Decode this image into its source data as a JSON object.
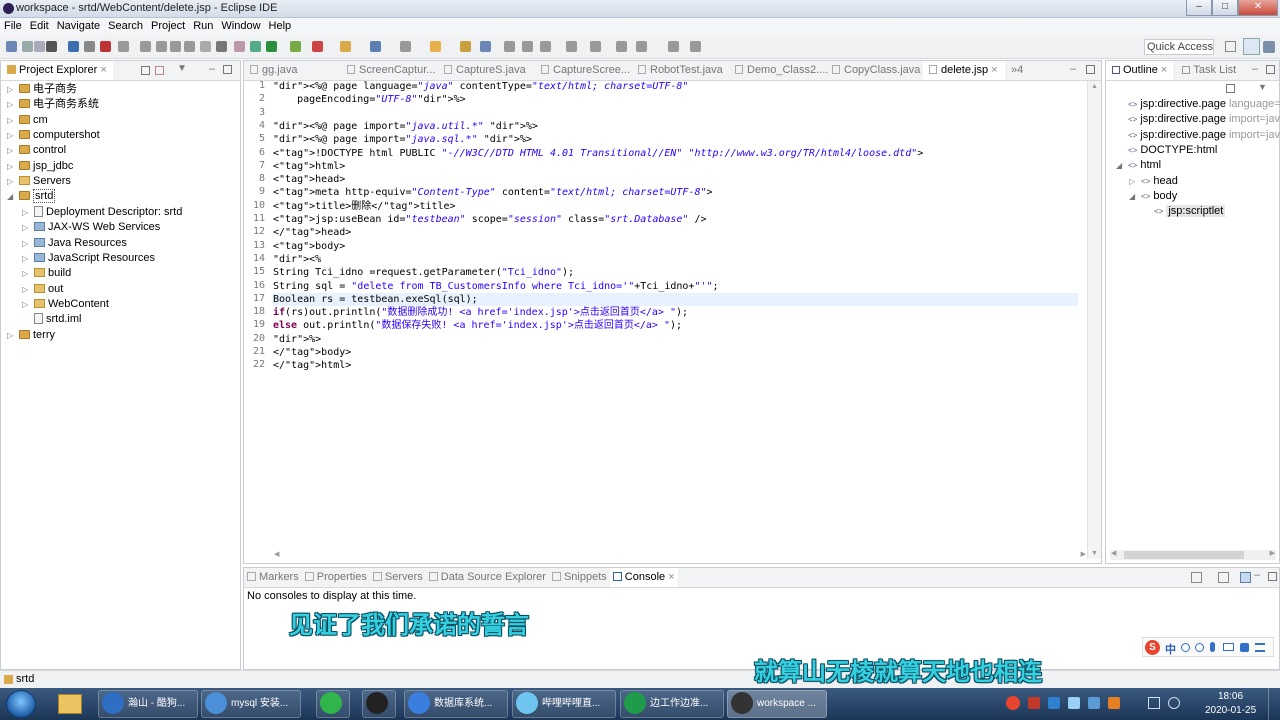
{
  "window": {
    "title": "workspace - srtd/WebContent/delete.jsp - Eclipse IDE"
  },
  "menu": [
    "File",
    "Edit",
    "Navigate",
    "Search",
    "Project",
    "Run",
    "Window",
    "Help"
  ],
  "toolbar": {
    "quick_access": "Quick Access"
  },
  "project_explorer": {
    "tab_label": "Project Explorer",
    "items": [
      {
        "label": "电子商务",
        "level": 0,
        "icon": "project-icon"
      },
      {
        "label": "电子商务系统",
        "level": 0,
        "icon": "project-icon"
      },
      {
        "label": "cm",
        "level": 0,
        "icon": "project-icon"
      },
      {
        "label": "computershot",
        "level": 0,
        "icon": "project-icon"
      },
      {
        "label": "control",
        "level": 0,
        "icon": "project-icon"
      },
      {
        "label": "jsp_jdbc",
        "level": 0,
        "icon": "project-icon"
      },
      {
        "label": "Servers",
        "level": 0,
        "icon": "folder-icon"
      },
      {
        "label": "srtd",
        "level": 0,
        "icon": "project-icon"
      },
      {
        "label": "Deployment Descriptor: srtd",
        "level": 1,
        "icon": "descriptor-icon"
      },
      {
        "label": "JAX-WS Web Services",
        "level": 1,
        "icon": "webservice-icon"
      },
      {
        "label": "Java Resources",
        "level": 1,
        "icon": "java-resources-icon"
      },
      {
        "label": "JavaScript Resources",
        "level": 1,
        "icon": "javascript-icon"
      },
      {
        "label": "build",
        "level": 1,
        "icon": "folder-icon"
      },
      {
        "label": "out",
        "level": 1,
        "icon": "folder-icon"
      },
      {
        "label": "WebContent",
        "level": 1,
        "icon": "folder-icon"
      },
      {
        "label": "srtd.iml",
        "level": 1,
        "icon": "file-icon"
      },
      {
        "label": "terry",
        "level": 0,
        "icon": "project-icon"
      }
    ]
  },
  "editor": {
    "tabs": [
      "gg.java",
      "ScreenCaptur...",
      "CaptureS.java",
      "CaptureScree...",
      "RobotTest.java",
      "Demo_Class2....",
      "CopyClass.java",
      "delete.jsp"
    ],
    "active_tab": "delete.jsp",
    "overflow": "»4",
    "lines": [
      "<%@ page language=\"java\" contentType=\"text/html; charset=UTF-8\"",
      "    pageEncoding=\"UTF-8\"%>",
      "",
      "<%@ page import=\"java.util.*\" %>",
      "<%@ page import=\"java.sql.*\" %>",
      "<!DOCTYPE html PUBLIC \"-//W3C//DTD HTML 4.01 Transitional//EN\" \"http://www.w3.org/TR/html4/loose.dtd\">",
      "<html>",
      "<head>",
      "<meta http-equiv=\"Content-Type\" content=\"text/html; charset=UTF-8\">",
      "<title>删除</title>",
      "<jsp:useBean id=\"testbean\" scope=\"session\" class=\"srt.Database\" />",
      "</head>",
      "<body>",
      "<%",
      "String Tci_idno =request.getParameter(\"Tci_idno\");",
      "String sql = \"delete from TB_CustomersInfo where Tci_idno='\"+Tci_idno+\"'\";",
      "Boolean rs = testbean.exeSql(sql);",
      "if(rs)out.println(\"数据删除成功! <a href='index.jsp'>点击返回首页</a> \");",
      "else out.println(\"数据保存失败! <a href='index.jsp'>点击返回首页</a> \");",
      "%>",
      "</body>",
      "</html>"
    ]
  },
  "outline": {
    "tabs": [
      "Outline",
      "Task List"
    ],
    "items": [
      {
        "label": "jsp:directive.page",
        "suffix": "language=",
        "level": 0
      },
      {
        "label": "jsp:directive.page",
        "suffix": "import=jav",
        "level": 0
      },
      {
        "label": "jsp:directive.page",
        "suffix": "import=jav",
        "level": 0
      },
      {
        "label": "DOCTYPE:html",
        "suffix": "",
        "level": 0
      },
      {
        "label": "html",
        "suffix": "",
        "level": 0
      },
      {
        "label": "head",
        "suffix": "",
        "level": 1
      },
      {
        "label": "body",
        "suffix": "",
        "level": 1
      },
      {
        "label": "jsp:scriptlet",
        "suffix": "",
        "level": 2
      }
    ]
  },
  "bottom": {
    "tabs": [
      "Markers",
      "Properties",
      "Servers",
      "Data Source Explorer",
      "Snippets",
      "Console"
    ],
    "active_tab": "Console",
    "message": "No consoles to display at this time."
  },
  "status_bar": {
    "text": "srtd"
  },
  "subtitles": {
    "line1": "见证了我们承诺的誓言",
    "line2": "就算山无棱就算天地也相连"
  },
  "ime_bar": {
    "label": "中"
  },
  "taskbar": {
    "items": [
      "瀚山 - 酷狗...",
      "mysql 安装...",
      "",
      "",
      "数据库系统...",
      "哔哩哔哩直...",
      "边工作边准...",
      "workspace ..."
    ],
    "time": "18:06",
    "date": "2020-01-25"
  },
  "colors": {
    "keyword": "#7f0055",
    "tag": "#3f7f7f",
    "string": "#2a00ff",
    "directive": "#bf5f3f",
    "subtitle": "#35d0e0"
  }
}
